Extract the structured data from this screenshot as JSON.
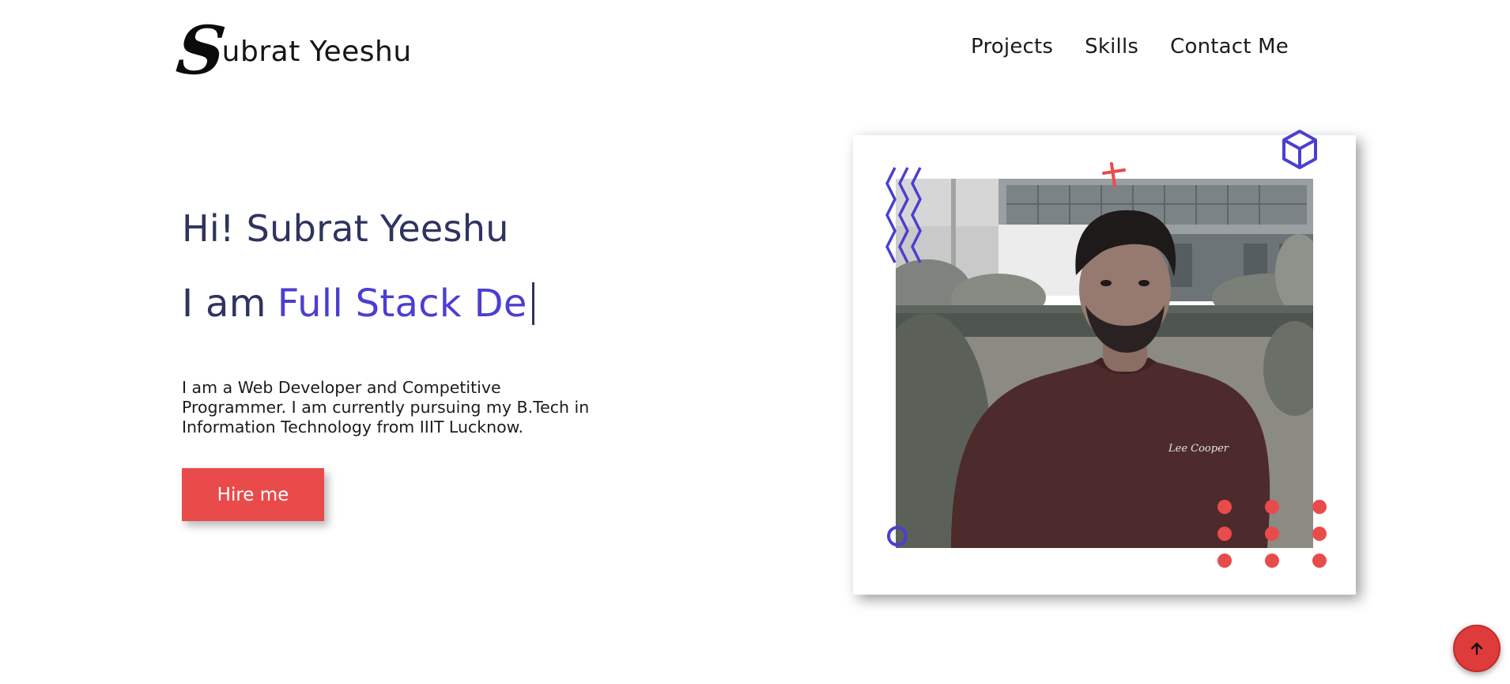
{
  "header": {
    "logo_initial": "S",
    "logo_rest": "ubrat Yeeshu",
    "nav": [
      {
        "label": "Projects"
      },
      {
        "label": "Skills"
      },
      {
        "label": "Contact Me"
      }
    ]
  },
  "hero": {
    "greeting": "Hi! Subrat Yeeshu",
    "role_prefix": "I am",
    "role_typed": "Full Stack De",
    "about": "I am a Web Developer and Competitive Programmer. I am currently pursuing my B.Tech in Information Technology from IIIT Lucknow.",
    "cta_label": "Hire me"
  },
  "photo": {
    "shirt_logo": "Lee Cooper"
  },
  "icons": {
    "scroll_top": "arrow-up-icon",
    "decor": [
      "zigzag-icon",
      "plus-icon",
      "cube-icon",
      "ring-icon",
      "dot-grid-icon"
    ]
  },
  "colors": {
    "accent_red": "#e94b4b",
    "accent_blue": "#4b3fd1",
    "heading_navy": "#2f3360"
  }
}
